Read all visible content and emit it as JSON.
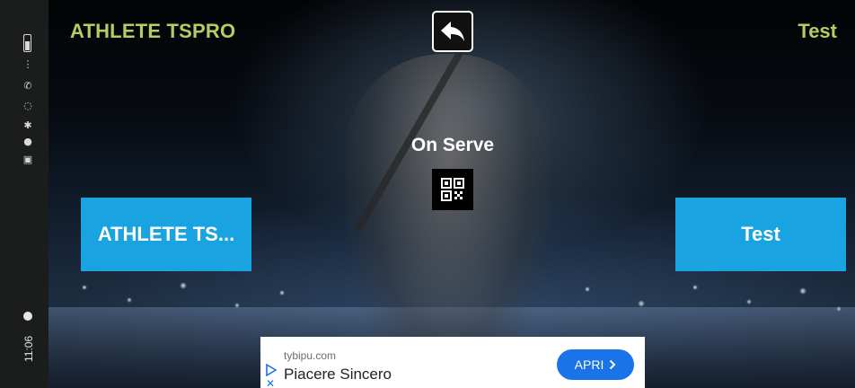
{
  "status_bar": {
    "time": "11:06"
  },
  "header": {
    "left_team": "ATHLETE TSPRO",
    "right_team": "Test",
    "back_icon": "undo-arrow-icon"
  },
  "center": {
    "serve_label": "On Serve",
    "qr_icon": "qr-code-icon"
  },
  "players": {
    "left_label": "ATHLETE TS...",
    "right_label": "Test"
  },
  "ad": {
    "domain": "tybipu.com",
    "title": "Piacere Sincero",
    "cta_label": "APRI",
    "cta_icon": "chevron-right-icon"
  },
  "colors": {
    "team_title": "#b8cc62",
    "player_button": "#1aa3e1",
    "ad_cta": "#1a73e8"
  }
}
